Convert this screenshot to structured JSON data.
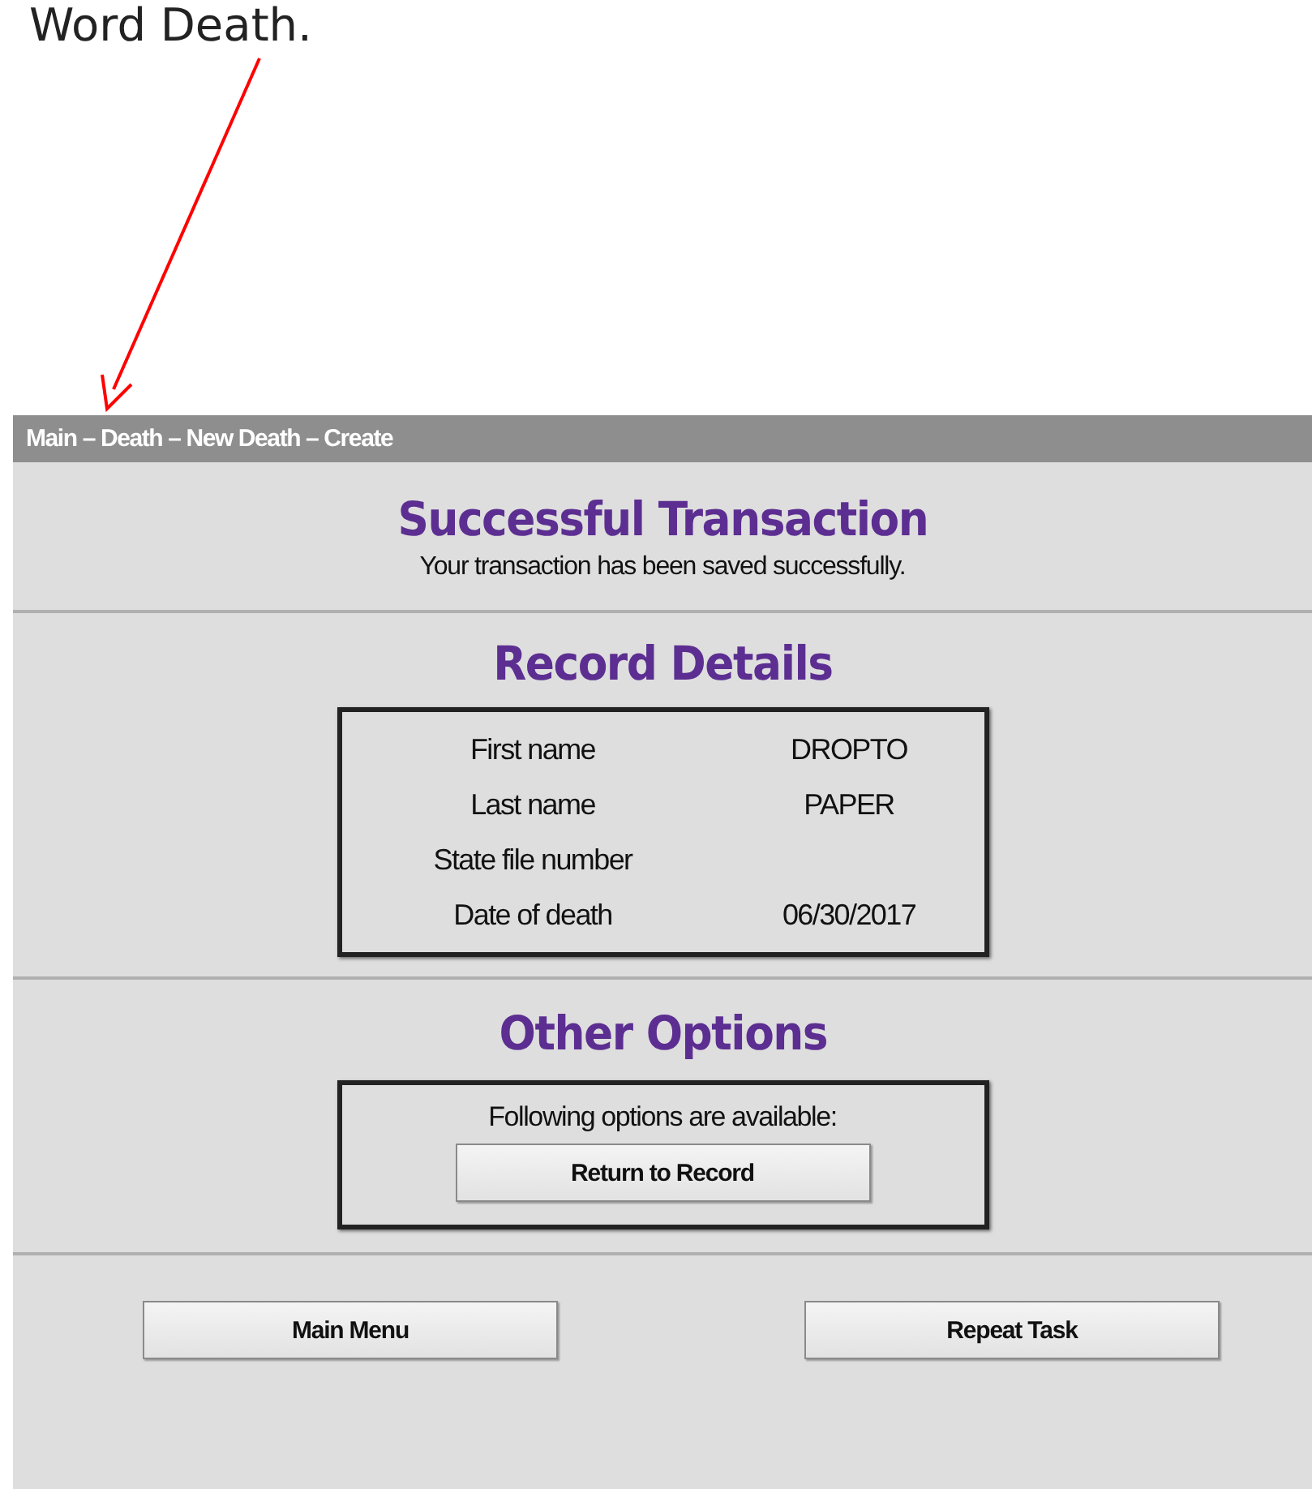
{
  "annotation": {
    "text": "Word Death."
  },
  "breadcrumb": "Main – Death – New Death – Create",
  "success": {
    "title": "Successful Transaction",
    "message": "Your transaction has been saved successfully."
  },
  "record_details": {
    "title": "Record Details",
    "rows": [
      {
        "label": "First name",
        "value": "DROPTO"
      },
      {
        "label": "Last name",
        "value": "PAPER"
      },
      {
        "label": "State file number"
      },
      {
        "label": "Date of death",
        "value": "06/30/2017"
      }
    ]
  },
  "other_options": {
    "title": "Other Options",
    "note": "Following options are available:",
    "buttons": [
      "Return to Record"
    ]
  },
  "footer_buttons": [
    "Main Menu",
    "Repeat Task"
  ]
}
